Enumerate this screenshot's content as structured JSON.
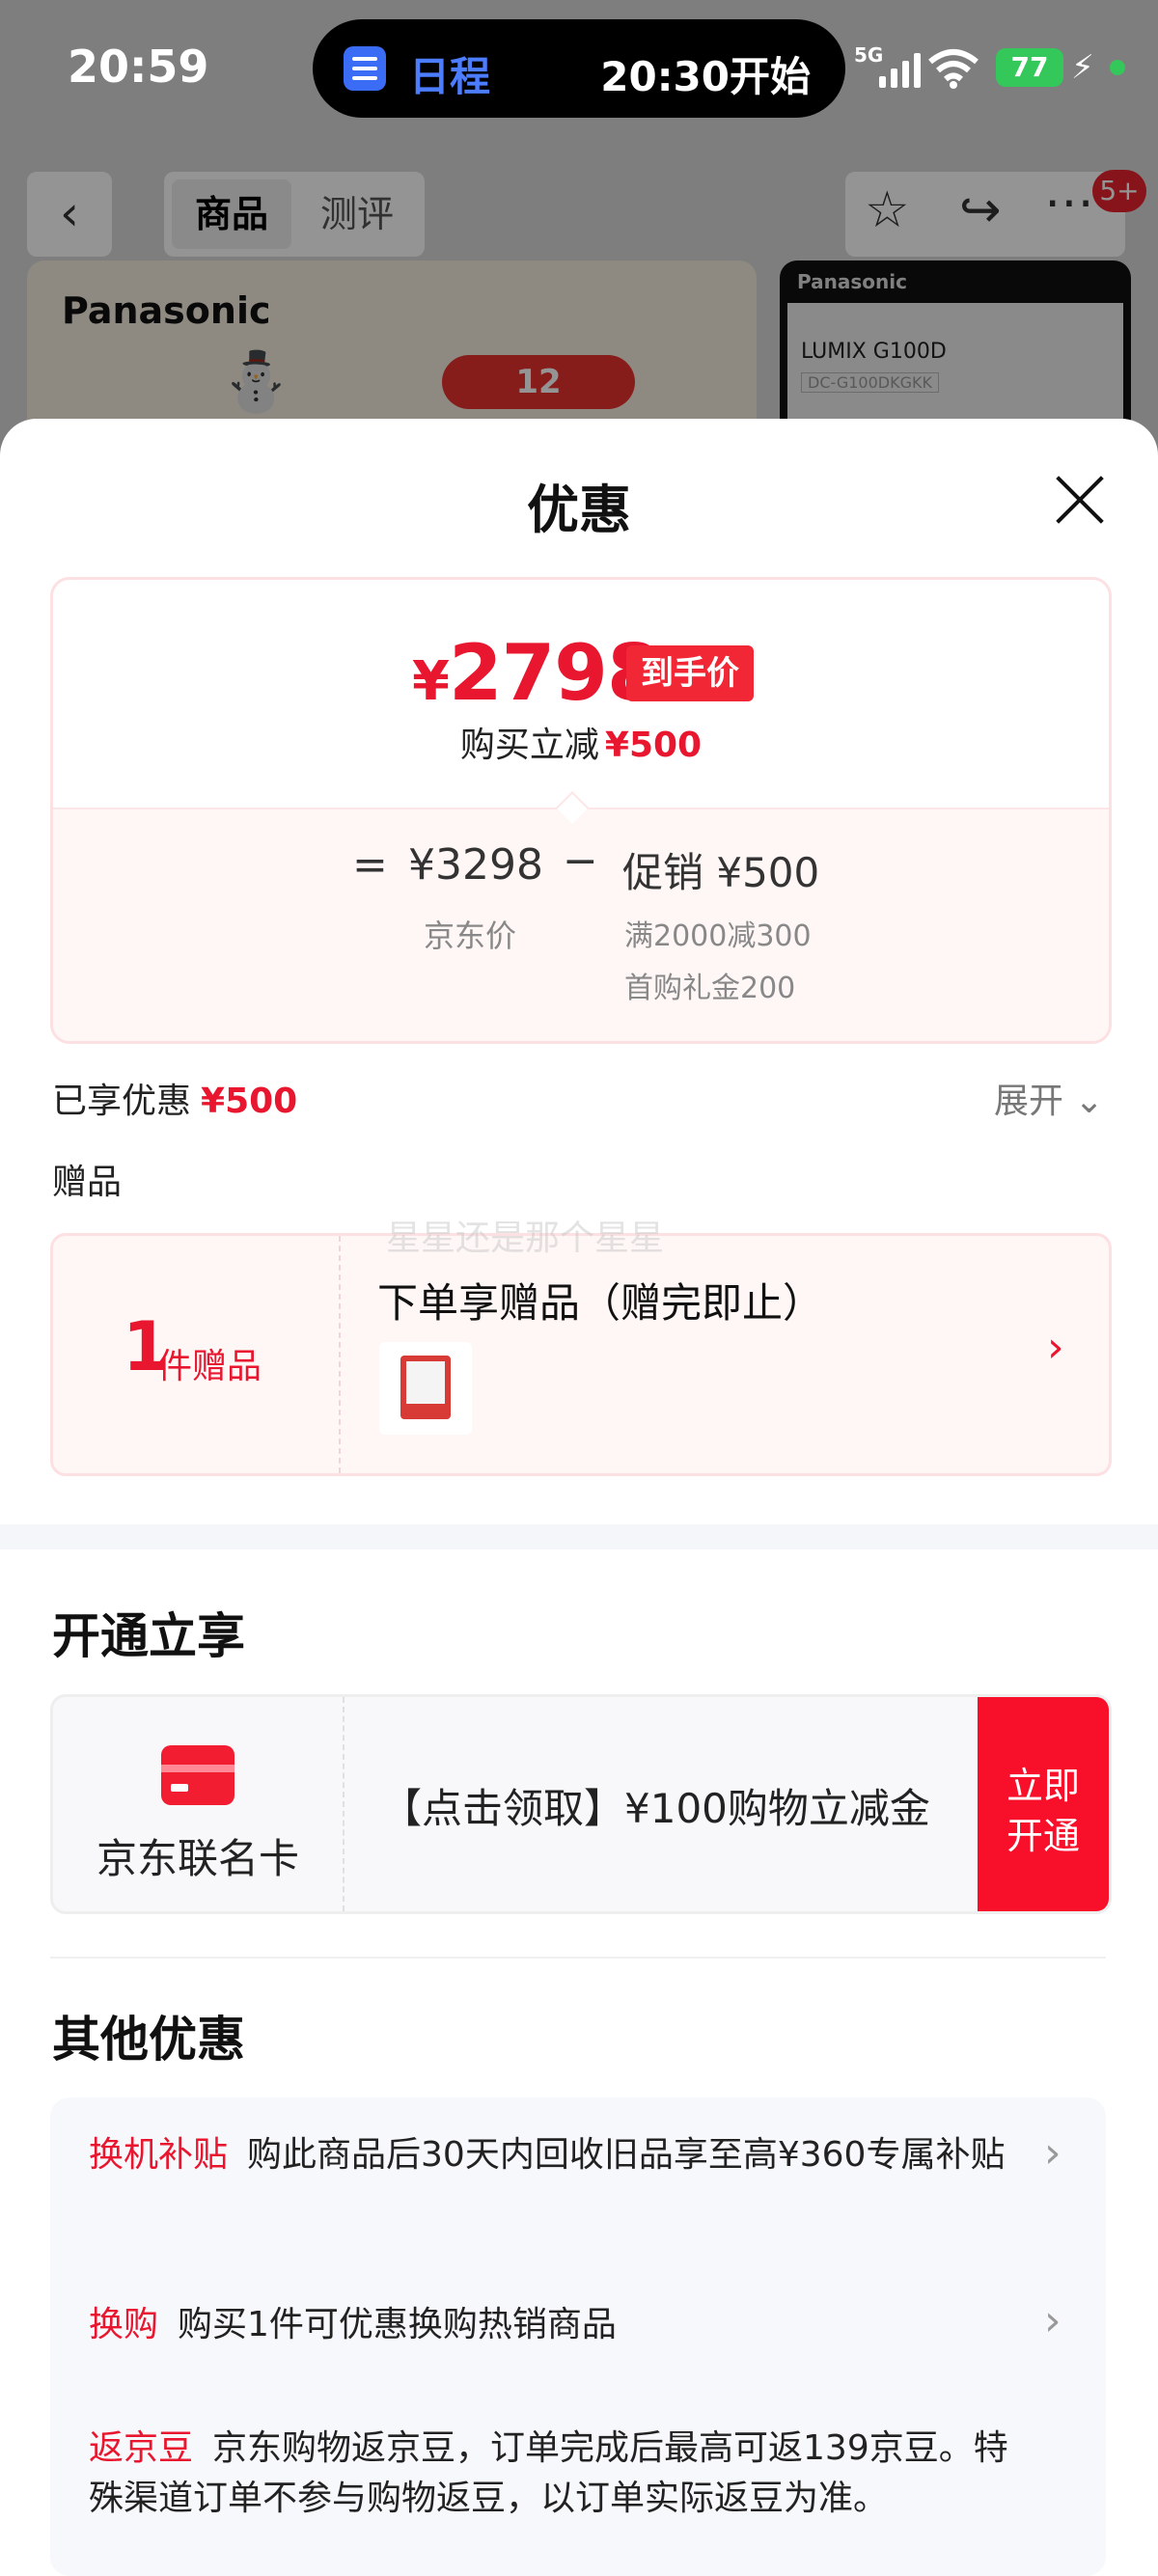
{
  "status_bar": {
    "time": "20:59",
    "schedule_app": "日程",
    "schedule_time": "20:30开始",
    "network": "5G",
    "battery": "77"
  },
  "product_header": {
    "tabs": [
      {
        "label": "商品"
      },
      {
        "label": "测评"
      }
    ],
    "badge": "5+"
  },
  "background": {
    "brand": "Panasonic",
    "promo_tag": "12",
    "camera_brand": "Panasonic",
    "camera_model": "LUMIX G100D",
    "camera_code": "DC-G100DKGKK"
  },
  "sheet": {
    "title": "优惠"
  },
  "price_card": {
    "final_price": "2798",
    "currency": "¥",
    "final_label": "到手价",
    "instant_prefix": "购买立减",
    "instant_amount": "¥500",
    "equals": "=",
    "jd_price": "¥3298",
    "jd_label": "京东价",
    "minus": "−",
    "promo": "促销 ¥500",
    "promo_detail_1": "满2000减300",
    "promo_detail_2": "首购礼金200"
  },
  "enjoyed": {
    "label": "已享优惠",
    "amount": "¥500",
    "expand": "展开"
  },
  "gifts": {
    "heading": "赠品",
    "count": "1",
    "count_unit": "件赠品",
    "title": "下单享赠品（赠完即止）",
    "watermark": "星星还是那个星星"
  },
  "open": {
    "heading": "开通立享",
    "card_name": "京东联名卡",
    "offer": "【点击领取】¥100购物立减金",
    "button": "立即\n开通"
  },
  "other": {
    "heading": "其他优惠",
    "items": [
      {
        "key": "换机补贴",
        "text": "购此商品后30天内回收旧品享至高¥360专属补贴"
      },
      {
        "key": "换购",
        "text": "购买1件可优惠换购热销商品"
      },
      {
        "key": "返京豆",
        "text": "京东购物返京豆，订单完成后最高可返139京豆。特殊渠道订单不参与购物返豆，以订单实际返豆为准。"
      }
    ]
  },
  "colors": {
    "accent_red": "#e8172f",
    "button_red": "#f8102a"
  }
}
